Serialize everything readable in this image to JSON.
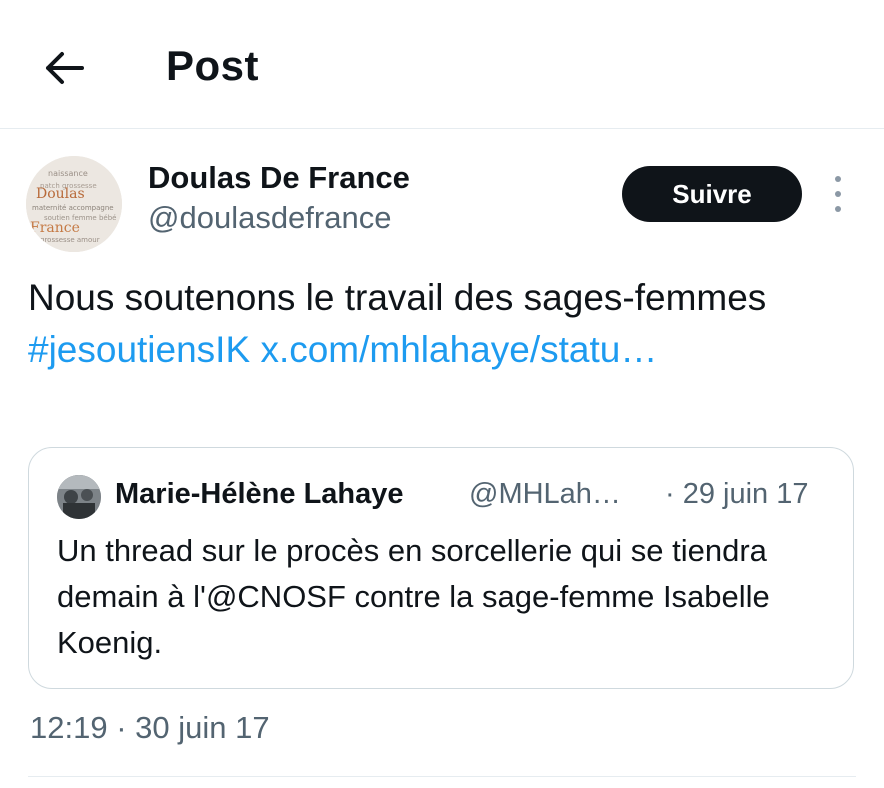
{
  "header": {
    "title": "Post",
    "back_icon": "arrow-left-icon"
  },
  "author": {
    "name": "Doulas De France",
    "handle": "@doulasdefrance",
    "follow_label": "Suivre",
    "more_icon": "vertical-ellipsis-icon",
    "avatar_words": [
      "naissance",
      "Doulas",
      "France",
      "maternité",
      "grossesse"
    ]
  },
  "tweet": {
    "text_plain": "Nous soutenons le travail des sages-femmes ",
    "hashtag": "#jesoutiensIK",
    "link_text": "x.com/mhlahaye/statu…"
  },
  "quote": {
    "name": "Marie-Hélène Lahaye",
    "handle": "@MHLah…",
    "date": "· 29 juin 17",
    "text": "Un thread sur le procès en sorcellerie qui se tiendra demain à l'@CNOSF contre la sage-femme Isabelle Koenig."
  },
  "meta": {
    "timestamp": "12:19 · 30 juin 17"
  },
  "colors": {
    "link": "#1d9bf0",
    "text": "#0f1419",
    "secondary": "#536471",
    "button_bg": "#0f1419",
    "border": "#cfd9de"
  }
}
